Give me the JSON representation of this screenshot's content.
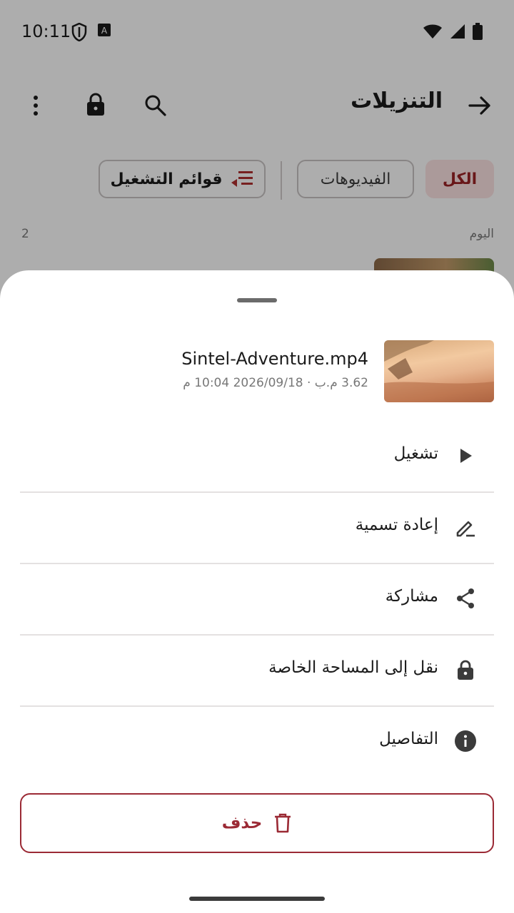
{
  "status_bar": {
    "time": "10:11",
    "icons": [
      "shield-icon",
      "keyboard-a-icon",
      "wifi-icon",
      "signal-icon",
      "battery-icon"
    ]
  },
  "app_bar": {
    "title": "التنزيلات",
    "actions": [
      "back-arrow-icon",
      "search-icon",
      "lock-icon",
      "more-vert-icon"
    ]
  },
  "filters": {
    "all": "الكل",
    "videos": "الفيديوهات",
    "playlists": "قوائم التشغيل",
    "active": "all"
  },
  "section": {
    "label": "اليوم",
    "count": "2"
  },
  "sheet": {
    "file": {
      "name": "Sintel-Adventure.mp4",
      "meta": "3.62 م.ب · 2026/09/18 10:04 م"
    },
    "menu": [
      {
        "label": "تشغيل",
        "icon": "play-icon"
      },
      {
        "label": "إعادة تسمية",
        "icon": "edit-icon"
      },
      {
        "label": "مشاركة",
        "icon": "share-icon"
      },
      {
        "label": "نقل إلى المساحة الخاصة",
        "icon": "lock-icon"
      },
      {
        "label": "التفاصيل",
        "icon": "info-icon"
      }
    ],
    "delete_label": "حذف"
  },
  "colors": {
    "accent": "#9b2a35",
    "chip_active_bg": "#fde3e3",
    "scrim": "rgba(0,0,0,0.32)"
  }
}
